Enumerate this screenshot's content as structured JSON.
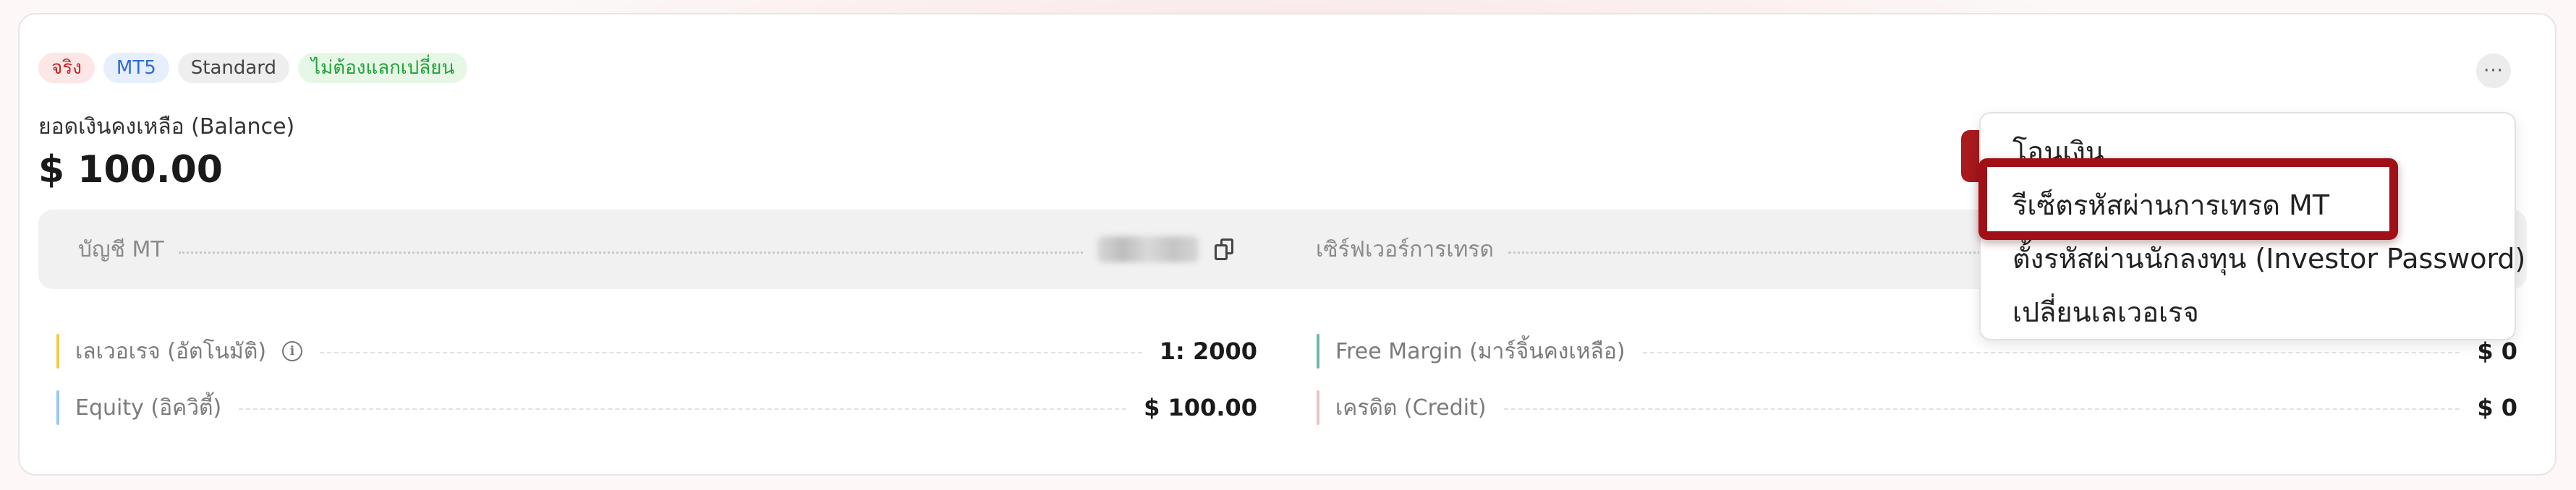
{
  "account": {
    "badges": [
      {
        "label": "จริง",
        "color": "#c8262b"
      },
      {
        "label": "MT5",
        "color": "#2f6bd6"
      },
      {
        "label": "Standard",
        "color": "#444444"
      },
      {
        "label": "ไม่ต้องแลกเปลี่ยน",
        "color": "#23a23a"
      }
    ],
    "more_label": "···",
    "balance_label": "ยอดเงินคงเหลือ (Balance)",
    "balance_value": "$ 100.00"
  },
  "info_bar": {
    "mt_account_label": "บัญชี MT",
    "server_label": "เซิร์ฟเวอร์การเทรด"
  },
  "details": {
    "leverage_label": "เลเวอเรจ (อัตโนมัติ)",
    "leverage_info_icon": "i",
    "leverage_value": "1: 2000",
    "equity_label": "Equity (อิควิตี้)",
    "equity_value": "$ 100.00",
    "free_margin_label": "Free Margin (มาร์จิ้นคงเหลือ)",
    "free_margin_value": "$ 0",
    "credit_label": "เครดิต (Credit)",
    "credit_value": "$ 0"
  },
  "accent_colors": {
    "leverage": "#f2c94c",
    "equity": "#9cc6f0",
    "free_margin": "#6fb8a8",
    "credit": "#e8c4c4",
    "highlight": "#a01016"
  },
  "menu": {
    "items": [
      {
        "label": "โอนเงิน"
      },
      {
        "label": "รีเซ็ตรหัสผ่านการเทรด MT"
      },
      {
        "label": "ตั้งรหัสผ่านนักลงทุน (Investor Password)"
      },
      {
        "label": "เปลี่ยนเลเวอเรจ"
      }
    ]
  }
}
